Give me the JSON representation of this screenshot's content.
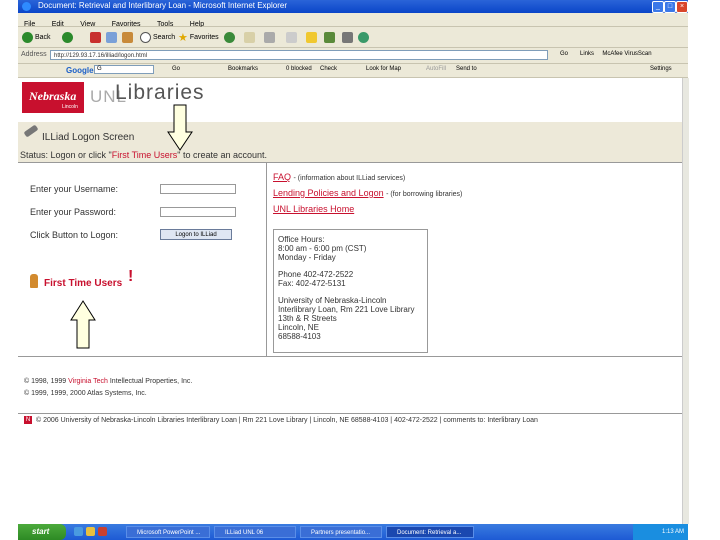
{
  "window": {
    "title": "Document: Retrieval and Interlibrary Loan - Microsoft Internet Explorer"
  },
  "menu": [
    "File",
    "Edit",
    "View",
    "Favorites",
    "Tools",
    "Help"
  ],
  "toolbar": {
    "back": "Back",
    "search": "Search",
    "favorites": "Favorites"
  },
  "address": {
    "label": "Address",
    "url": "http://129.93.17.16/illiad/logon.html",
    "go": "Go",
    "links": "Links",
    "addon": "McAfee VirusScan"
  },
  "google_bar": {
    "brand": "Google",
    "query": "G",
    "go": "Go",
    "bookmarks": "Bookmarks",
    "blocked": "0 blocked",
    "check": "Check",
    "lookup": "Look for Map",
    "autofill": "AutoFill",
    "send": "Send to",
    "settings": "Settings"
  },
  "header": {
    "nebraska": "Nebraska",
    "lincoln": "Lincoln",
    "unl": "UNL",
    "libraries": "Libraries"
  },
  "page": {
    "title": "ILLiad Logon Screen",
    "status_prefix": "Status:  Logon or click \"",
    "status_link": "First Time Users",
    "status_suffix": "\" to create an account."
  },
  "form": {
    "username_label": "Enter your Username:",
    "password_label": "Enter your Password:",
    "button_label": "Click Button to Logon:",
    "logon_button": "Logon to ILLiad",
    "first_time": "First Time Users",
    "bang": "!"
  },
  "links": {
    "faq": "FAQ",
    "faq_desc": "- (information about ILLiad services)",
    "policies": "Lending Policies and Logon",
    "policies_desc": "- (for borrowing libraries)",
    "home": "UNL Libraries Home"
  },
  "office": {
    "hours_title": "Office Hours:",
    "hours": "8:00 am - 6:00 pm (CST)",
    "days": "Monday - Friday",
    "phone": "Phone 402-472-2522",
    "fax": "Fax: 402-472-5131",
    "org": "University of Nebraska-Lincoln",
    "dept": "Interlibrary Loan, Rm 221 Love Library",
    "street": "13th & R Streets",
    "city": "Lincoln, NE",
    "zip": "68588-4103"
  },
  "copyright": {
    "line1_prefix": "© 1998, 1999 ",
    "line1_link": "Virginia Tech",
    "line1_suffix": " Intellectual Properties, Inc.",
    "line2": "© 1999, 1999, 2000 Atlas Systems, Inc."
  },
  "footer": {
    "text": "© 2006 University of Nebraska-Lincoln Libraries Interlibrary Loan | Rm 221 Love Library | Lincoln, NE 68588-4103 | 402-472-2522 | comments to: Interlibrary Loan"
  },
  "taskbar": {
    "start": "start",
    "tasks": [
      "Microsoft PowerPoint ...",
      "ILLiad UNL 06",
      "Partners presentatio...",
      "Document: Retrieval a..."
    ],
    "clock": "1:13 AM"
  }
}
